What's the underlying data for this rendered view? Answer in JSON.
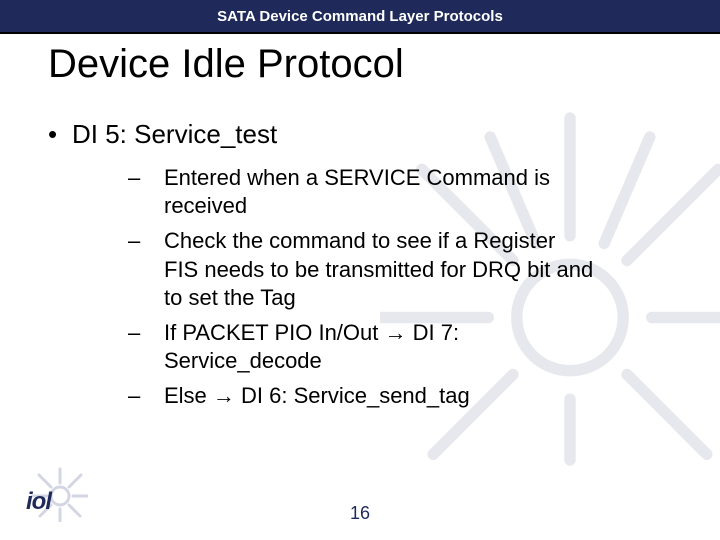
{
  "topbar": {
    "title": "SATA Device Command Layer Protocols"
  },
  "slide": {
    "title": "Device Idle Protocol"
  },
  "content": {
    "item": {
      "bullet": "•",
      "text": "DI 5: Service_test",
      "sub_dash": "–",
      "subs": [
        "Entered when a SERVICE Command is received",
        "Check the command to see if a Register FIS needs to be transmitted for DRQ bit and to set the Tag",
        "If PACKET PIO In/Out → DI 7: Service_decode",
        "Else → DI 6: Service_send_tag"
      ]
    }
  },
  "footer": {
    "page_number": "16",
    "logo_text": "iol"
  }
}
